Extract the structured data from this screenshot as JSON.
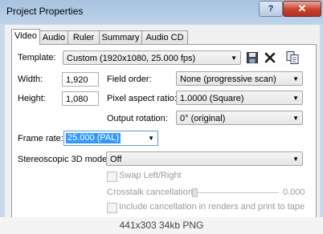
{
  "window": {
    "title": "Project Properties",
    "help_label": "?",
    "close_label": "✕"
  },
  "tabs": [
    {
      "label": "Video",
      "active": true
    },
    {
      "label": "Audio"
    },
    {
      "label": "Ruler"
    },
    {
      "label": "Summary"
    },
    {
      "label": "Audio CD"
    }
  ],
  "video": {
    "template": {
      "label": "Template:",
      "value": "Custom (1920x1080, 25.000 fps)",
      "icons": [
        "save-icon",
        "delete-icon",
        "copy-icon"
      ]
    },
    "width": {
      "label": "Width:",
      "value": "1,920"
    },
    "height": {
      "label": "Height:",
      "value": "1,080"
    },
    "field_order": {
      "label": "Field order:",
      "value": "None (progressive scan)"
    },
    "pixel_aspect_ratio": {
      "label": "Pixel aspect ratio:",
      "value": "1.0000 (Square)"
    },
    "output_rotation": {
      "label": "Output rotation:",
      "value": "0° (original)"
    },
    "frame_rate": {
      "label": "Frame rate:",
      "value": "25.000 (PAL)"
    },
    "stereoscopic_3d_mode": {
      "label": "Stereoscopic 3D mode:",
      "value": "Off"
    },
    "swap_left_right": {
      "label": "Swap Left/Right",
      "checked": false,
      "enabled": false
    },
    "crosstalk_cancellation": {
      "label": "Crosstalk cancellation:",
      "value": "0.000",
      "enabled": false
    },
    "include_cancellation": {
      "label": "Include cancellation in renders and print to tape",
      "checked": false,
      "enabled": false
    }
  },
  "image_caption": "441x303 34kb PNG"
}
